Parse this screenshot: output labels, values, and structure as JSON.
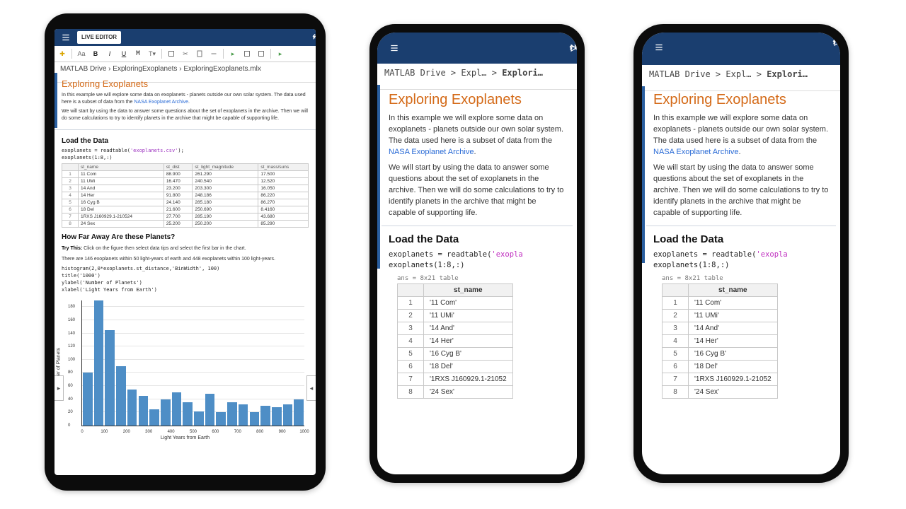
{
  "colors": {
    "header": "#1a3e6f",
    "accent": "#d46a18",
    "link": "#2a6bd6",
    "bar": "#4e8ec6"
  },
  "tablet": {
    "pill": "LIVE EDITOR",
    "breadcrumb": "MATLAB Drive › ExploringExoplanets › ExploringExoplanets.mlx",
    "title": "Exploring Exoplanets",
    "intro1_a": "In this example we will explore some data on exoplanets - planets outside our own solar system. The data used here is a subset of data from the ",
    "intro1_link": "NASA Exoplanet Archive",
    "intro1_b": ".",
    "intro2": "We will start by using the data to answer some questions about the set of exoplanets in the archive. Then we will do some calculations to try to identify planets in the archive that might be capable of supporting life.",
    "sect_load": "Load the Data",
    "code_load_a": "exoplanets = readtable(",
    "code_load_str": "'exoplanets.csv'",
    "code_load_b": ");\nexoplanets(1:8,:)",
    "table": {
      "headers": [
        "",
        "st_name",
        "st_dist",
        "st_light_magnitude",
        "st_mass/suns"
      ],
      "rows": [
        [
          "1",
          "11 Com",
          "88.900",
          "261.290",
          "17.500"
        ],
        [
          "2",
          "11 UMi",
          "16.470",
          "240.540",
          "12.520"
        ],
        [
          "3",
          "14 And",
          "23.200",
          "203.300",
          "16.050"
        ],
        [
          "4",
          "14 Her",
          "91.800",
          "248.186",
          "86.220"
        ],
        [
          "5",
          "16 Cyg B",
          "24.140",
          "285.180",
          "86.270"
        ],
        [
          "6",
          "18 Del",
          "21.600",
          "250.690",
          "8.4160"
        ],
        [
          "7",
          "1RXS J160929.1-210524",
          "27.700",
          "285.190",
          "43.680"
        ],
        [
          "8",
          "24 Sex",
          "25.200",
          "250.200",
          "85.290"
        ]
      ]
    },
    "sect_dist": "How Far Away Are these Planets?",
    "trythis_label": "Try This:",
    "trythis_text": " Click on the figure then select data tips and select the first bar in the chart.",
    "dist_note": "There are 146 exoplanets within 50 light-years of earth and 448 exoplanets within 100 light-years.",
    "code_hist": "histogram(2,0*exoplanets.st_distance,'BinWidth', 100)\ntitle('1000')\nylabel('Number of Planets')\nxlabel('Light Years from Earth')"
  },
  "phone": {
    "breadcrumb_a": "MATLAB Drive",
    "breadcrumb_b": "Expl…",
    "breadcrumb_c": "Explori…",
    "title": "Exploring Exoplanets",
    "p1_a": "In this example we will explore some data on exoplanets - planets outside our own solar system. The data used here is a subset of data from the ",
    "p1_link": "NASA Exoplanet Archive",
    "p1_b": ".",
    "p2": "We will start by using the data to answer some questions about the set of exoplanets in the archive. Then we will do some calculations to try to identify planets in the archive that might be capable of supporting life.",
    "sect_load": "Load the Data",
    "code_a": "exoplanets = readtable(",
    "code_str": "'exopla",
    "code_c": "exoplanets(1:8,:)",
    "ans_label": "ans = 8x21 table",
    "th": "st_name",
    "rows": [
      [
        "1",
        "'11 Com'"
      ],
      [
        "2",
        "'11 UMi'"
      ],
      [
        "3",
        "'14 And'"
      ],
      [
        "4",
        "'14 Her'"
      ],
      [
        "5",
        "'16 Cyg B'"
      ],
      [
        "6",
        "'18 Del'"
      ],
      [
        "7",
        "'1RXS J160929.1-21052"
      ],
      [
        "8",
        "'24 Sex'"
      ]
    ]
  },
  "chart_data": {
    "type": "bar",
    "title": "",
    "xlabel": "Light Years from Earth",
    "ylabel": "Number of Planets",
    "x": [
      50,
      100,
      150,
      200,
      250,
      300,
      350,
      400,
      450,
      500,
      550,
      600,
      650,
      700,
      750,
      800,
      850,
      900,
      950,
      1000
    ],
    "values": [
      80,
      190,
      145,
      90,
      55,
      45,
      25,
      40,
      50,
      35,
      22,
      48,
      20,
      35,
      32,
      20,
      30,
      28,
      32,
      40
    ],
    "xticks": [
      0,
      100,
      200,
      300,
      400,
      500,
      600,
      700,
      800,
      900,
      1000
    ],
    "yticks": [
      0,
      20,
      40,
      60,
      80,
      100,
      120,
      140,
      160,
      180
    ],
    "ylim": [
      0,
      190
    ]
  }
}
